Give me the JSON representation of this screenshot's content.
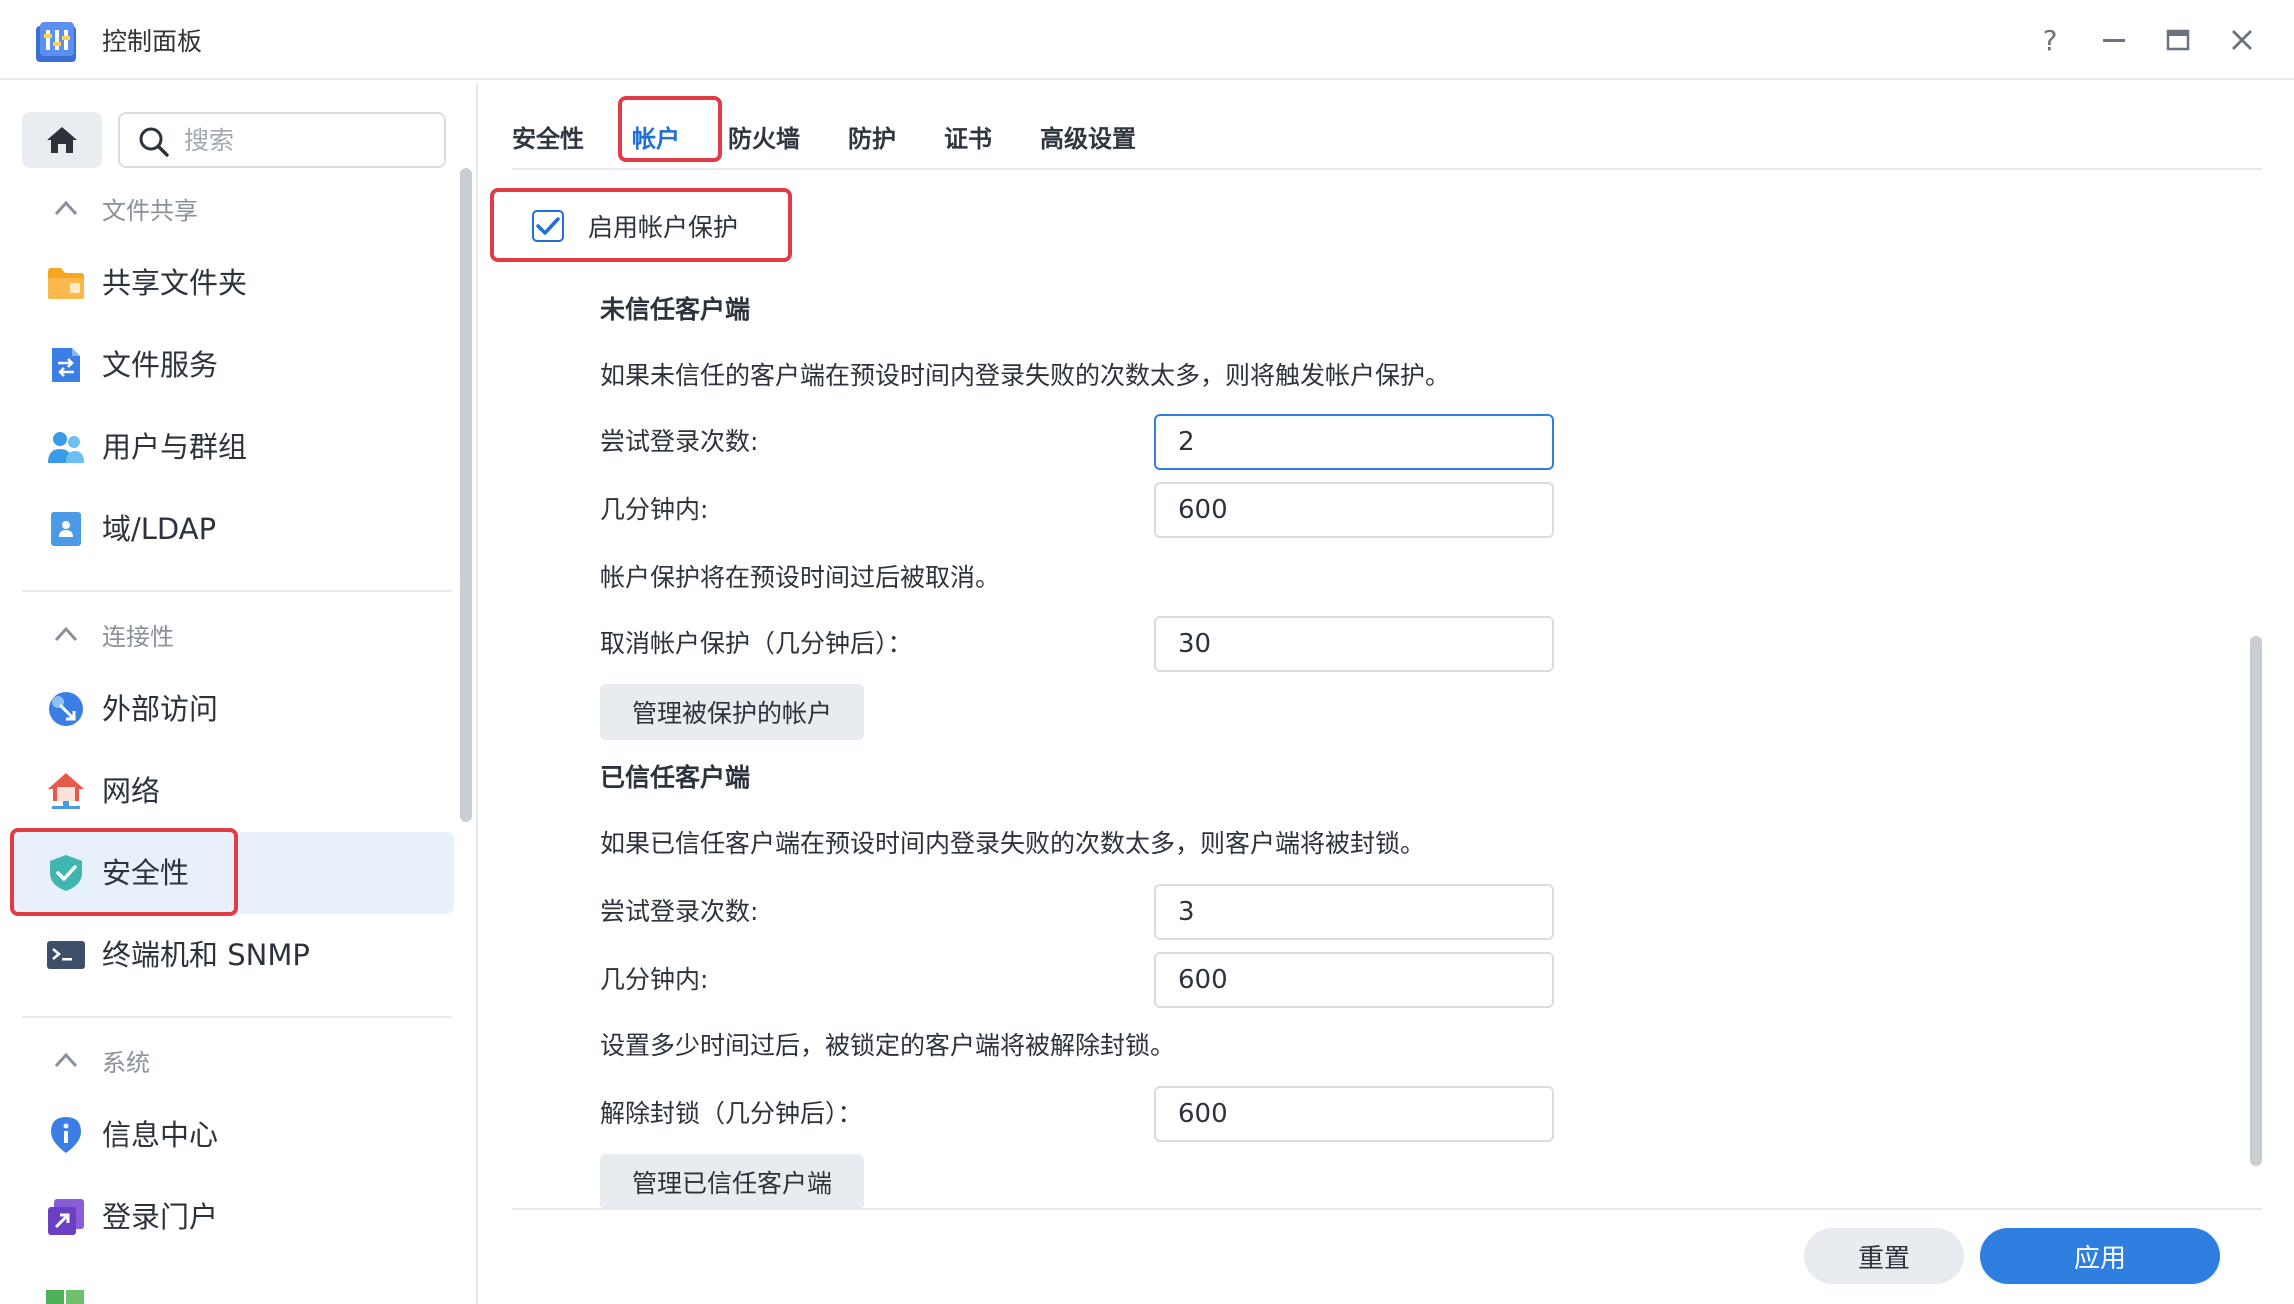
{
  "window": {
    "title": "控制面板",
    "controls": {
      "help": "?",
      "minimize": "—",
      "maximize": "▭",
      "close": "✕"
    }
  },
  "sidebar": {
    "search_placeholder": "搜索",
    "sections": [
      {
        "label": "文件共享",
        "items": [
          {
            "label": "共享文件夹",
            "icon": "folder-icon"
          },
          {
            "label": "文件服务",
            "icon": "file-services-icon"
          },
          {
            "label": "用户与群组",
            "icon": "users-icon"
          },
          {
            "label": "域/LDAP",
            "icon": "domain-ldap-icon"
          }
        ]
      },
      {
        "label": "连接性",
        "items": [
          {
            "label": "外部访问",
            "icon": "external-access-icon"
          },
          {
            "label": "网络",
            "icon": "network-icon"
          },
          {
            "label": "安全性",
            "icon": "shield-icon",
            "active": true
          },
          {
            "label": "终端机和 SNMP",
            "icon": "terminal-icon"
          }
        ]
      },
      {
        "label": "系统",
        "items": [
          {
            "label": "信息中心",
            "icon": "info-icon"
          },
          {
            "label": "登录门户",
            "icon": "login-portal-icon"
          }
        ]
      }
    ]
  },
  "tabs": [
    {
      "label": "安全性"
    },
    {
      "label": "帐户",
      "active": true
    },
    {
      "label": "防火墙"
    },
    {
      "label": "防护"
    },
    {
      "label": "证书"
    },
    {
      "label": "高级设置"
    }
  ],
  "account": {
    "enable_label": "启用帐户保护",
    "enable_checked": true,
    "untrusted": {
      "heading": "未信任客户端",
      "desc": "如果未信任的客户端在预设时间内登录失败的次数太多，则将触发帐户保护。",
      "attempts_label": "尝试登录次数:",
      "attempts_value": "2",
      "within_label": "几分钟内:",
      "within_value": "600",
      "cancel_desc": "帐户保护将在预设时间过后被取消。",
      "cancel_label": "取消帐户保护（几分钟后）：",
      "cancel_value": "30",
      "manage_button": "管理被保护的帐户"
    },
    "trusted": {
      "heading": "已信任客户端",
      "desc": "如果已信任客户端在预设时间内登录失败的次数太多，则客户端将被封锁。",
      "attempts_label": "尝试登录次数:",
      "attempts_value": "3",
      "within_label": "几分钟内:",
      "within_value": "600",
      "unblock_desc": "设置多少时间过后，被锁定的客户端将被解除封锁。",
      "unblock_label": "解除封锁（几分钟后）：",
      "unblock_value": "600",
      "manage_button": "管理已信任客户端"
    }
  },
  "footer": {
    "reset_label": "重置",
    "apply_label": "应用"
  },
  "colors": {
    "accent": "#2f7fe0",
    "highlight": "#e23b45",
    "active_bg": "#e7f0fb"
  }
}
